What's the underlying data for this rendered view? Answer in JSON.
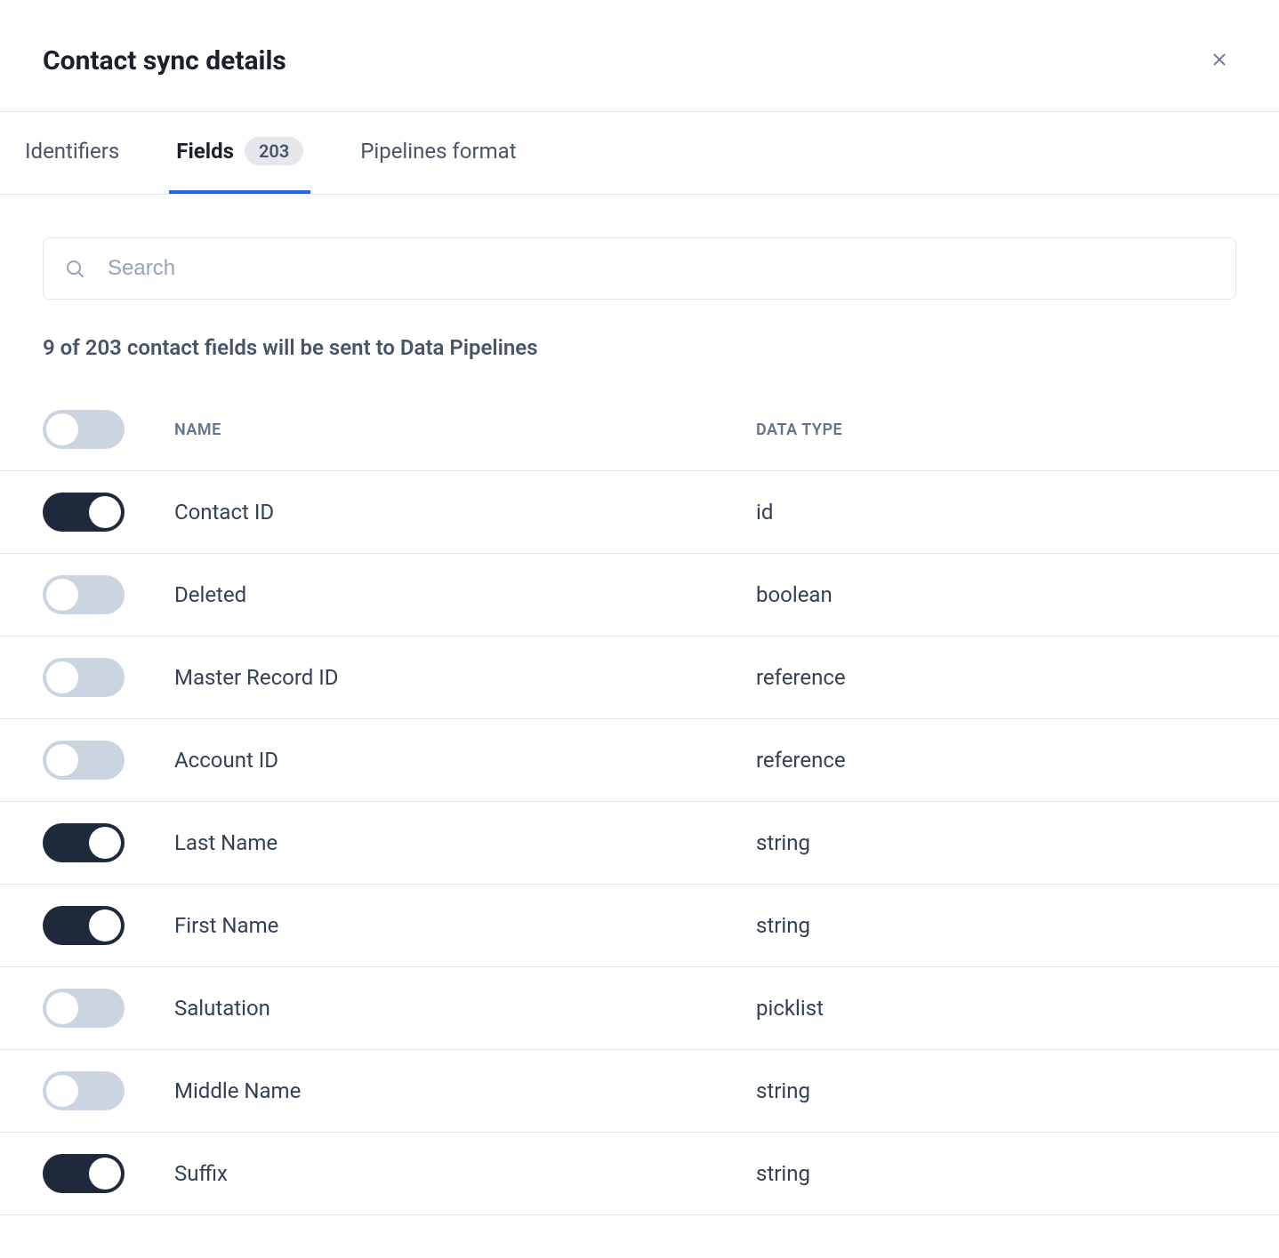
{
  "header": {
    "title": "Contact sync details"
  },
  "tabs": {
    "identifiers": "Identifiers",
    "fields": "Fields",
    "fields_count": "203",
    "pipelines": "Pipelines format",
    "active": "fields"
  },
  "search": {
    "placeholder": "Search",
    "value": ""
  },
  "status": "9 of 203 contact fields will be sent to Data Pipelines",
  "columns": {
    "name": "Name",
    "data_type": "Data Type"
  },
  "rows": [
    {
      "enabled": true,
      "name": "Contact ID",
      "type": "id"
    },
    {
      "enabled": false,
      "name": "Deleted",
      "type": "boolean"
    },
    {
      "enabled": false,
      "name": "Master Record ID",
      "type": "reference"
    },
    {
      "enabled": false,
      "name": "Account ID",
      "type": "reference"
    },
    {
      "enabled": true,
      "name": "Last Name",
      "type": "string"
    },
    {
      "enabled": true,
      "name": "First Name",
      "type": "string"
    },
    {
      "enabled": false,
      "name": "Salutation",
      "type": "picklist"
    },
    {
      "enabled": false,
      "name": "Middle Name",
      "type": "string"
    },
    {
      "enabled": true,
      "name": "Suffix",
      "type": "string"
    }
  ]
}
